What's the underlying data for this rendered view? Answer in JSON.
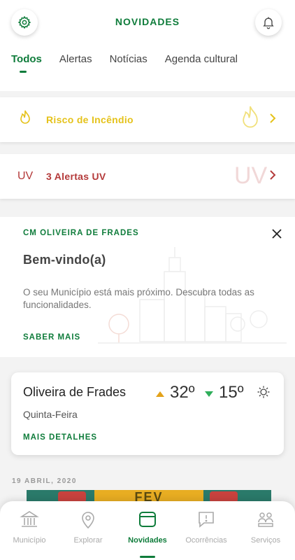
{
  "header": {
    "title": "NOVIDADES",
    "settings_icon": "gear-icon",
    "notifications_icon": "bell-icon"
  },
  "tabs": [
    {
      "label": "Todos",
      "active": true
    },
    {
      "label": "Alertas",
      "active": false
    },
    {
      "label": "Notícias",
      "active": false
    },
    {
      "label": "Agenda cultural",
      "active": false
    }
  ],
  "alerts": {
    "fire": {
      "label": "Risco de Incêndio",
      "icon": "flame-icon",
      "color": "#e5c21a"
    },
    "uv": {
      "label": "3 Alertas UV",
      "icon_text": "UV",
      "watermark_text": "UV",
      "color": "#b43a3a"
    }
  },
  "welcome": {
    "eyebrow": "CM OLIVEIRA DE FRADES",
    "title": "Bem-vindo(a)",
    "text": "O seu Município está mais próximo. Descubra todas as funcionalidades.",
    "cta": "SABER MAIS"
  },
  "weather": {
    "city": "Oliveira de Frades",
    "day": "Quinta-Feira",
    "max_temp": "32º",
    "min_temp": "15º",
    "more_label": "MAIS DETALHES",
    "icon": "sun-icon"
  },
  "news": {
    "date": "19 ABRIL, 2020",
    "banner_text": "FEV"
  },
  "bottom_nav": [
    {
      "label": "Município",
      "icon": "building-icon",
      "active": false
    },
    {
      "label": "Explorar",
      "icon": "map-pin-icon",
      "active": false
    },
    {
      "label": "Novidades",
      "icon": "news-icon",
      "active": true
    },
    {
      "label": "Ocorrências",
      "icon": "report-icon",
      "active": false
    },
    {
      "label": "Serviços",
      "icon": "services-icon",
      "active": false
    }
  ],
  "colors": {
    "brand": "#0f7c3b",
    "fire": "#e5c21a",
    "uv": "#b43a3a",
    "temp_up": "#e3a21a",
    "temp_down": "#2fae5a"
  }
}
